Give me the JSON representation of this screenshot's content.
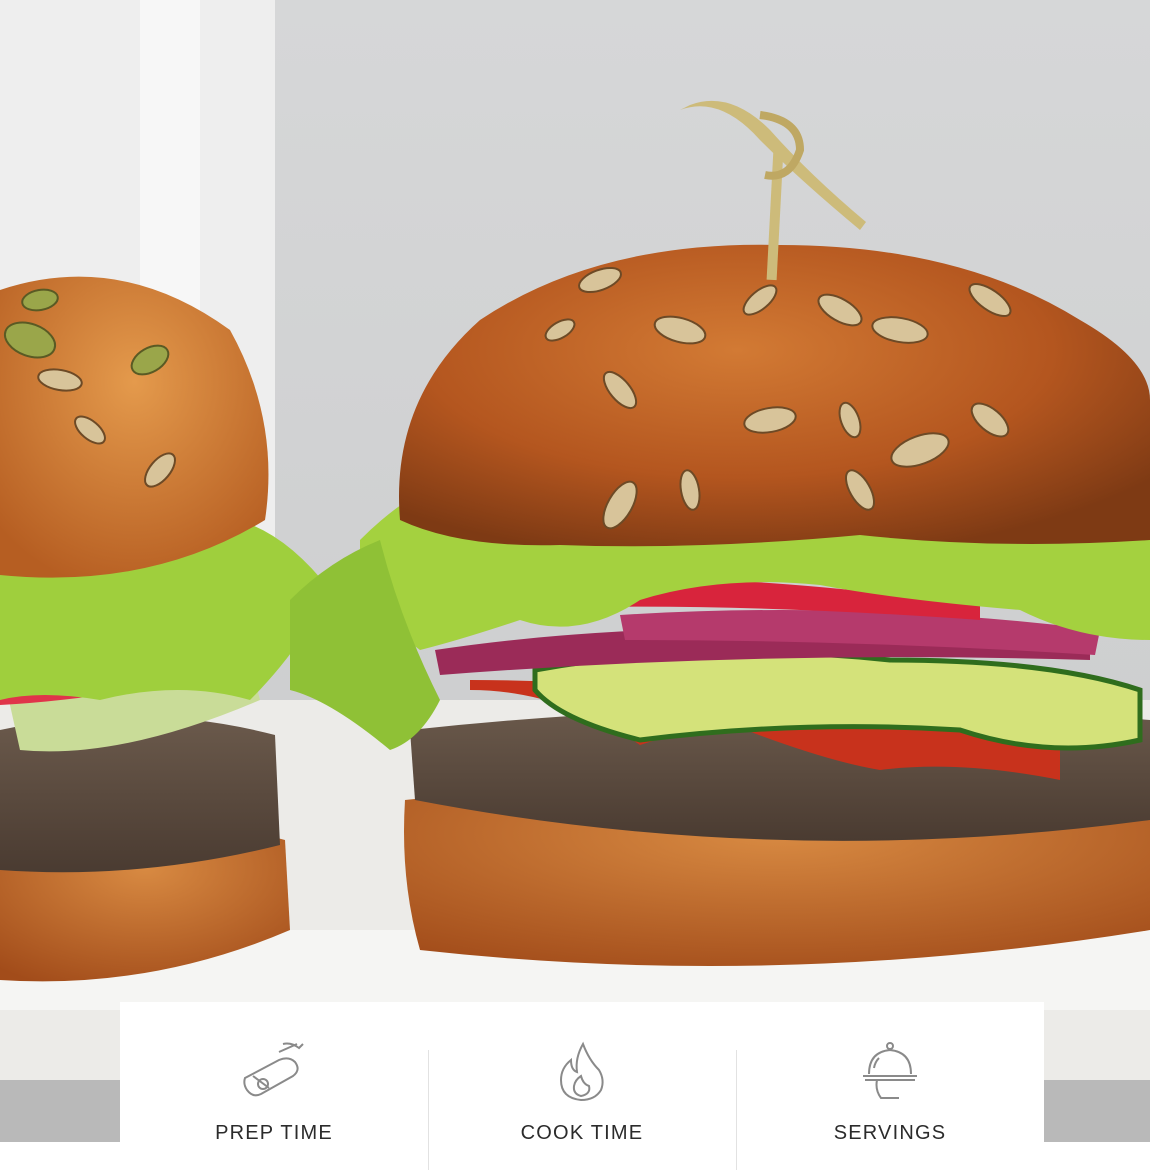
{
  "hero_image": {
    "subject": "two-burgers-with-seeded-buns-lettuce-radish-onion-cucumber-bean-patty",
    "colors": {
      "background": "#cfd0d1",
      "bun": "#b4561f",
      "lettuce": "#9fcf3d",
      "patty": "#5a4a3e",
      "plate": "#f4f4f2"
    }
  },
  "recipe_meta": {
    "items": [
      {
        "label": "PREP TIME",
        "icon": "cutting-board-knife-icon"
      },
      {
        "label": "COOK TIME",
        "icon": "flame-icon"
      },
      {
        "label": "SERVINGS",
        "icon": "serving-cloche-icon"
      }
    ]
  }
}
